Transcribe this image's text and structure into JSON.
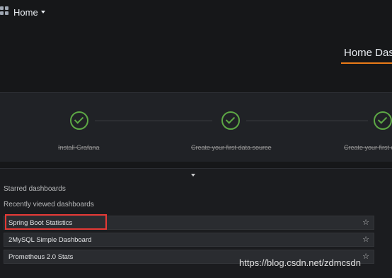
{
  "header": {
    "home_label": "Home",
    "page_title": "Home Dashboard"
  },
  "onboarding": {
    "steps": [
      {
        "label": "Install Grafana",
        "done": true
      },
      {
        "label": "Create your first data source",
        "done": true
      },
      {
        "label": "Create your first dashboard",
        "done": true
      }
    ]
  },
  "dashboards": {
    "starred_title": "Starred dashboards",
    "recent_title": "Recently viewed dashboards",
    "recent": [
      {
        "name": "Spring Boot Statistics",
        "highlighted": true
      },
      {
        "name": "2MySQL Simple Dashboard",
        "highlighted": false
      },
      {
        "name": "Prometheus 2.0 Stats",
        "highlighted": false
      }
    ]
  },
  "watermark": "https://blog.csdn.net/zdmcsdn",
  "colors": {
    "background": "#161719",
    "check_green": "#5da845",
    "accent_orange": "#eb7b18",
    "highlight_red": "#e53935"
  }
}
